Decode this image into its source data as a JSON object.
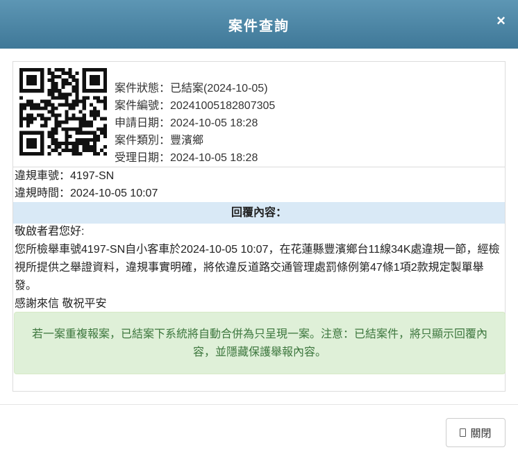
{
  "header": {
    "title": "案件查詢",
    "close_glyph": "×"
  },
  "case": {
    "rows": [
      {
        "label": "案件狀態：",
        "value": "已結案(2024-10-05)"
      },
      {
        "label": "案件編號：",
        "value": "20241005182807305"
      },
      {
        "label": "申請日期：",
        "value": "2024-10-05 18:28"
      },
      {
        "label": "案件類別：",
        "value": "豐濱鄉"
      },
      {
        "label": "受理日期：",
        "value": "2024-10-05 18:28"
      }
    ]
  },
  "violation": {
    "plate_label": "違規車號：",
    "plate": "4197-SN",
    "time_label": "違規時間：",
    "time": "2024-10-05 10:07"
  },
  "reply": {
    "heading": "回覆內容：",
    "greeting": "敬啟者君您好:",
    "body": "您所檢舉車號4197-SN自小客車於2024-10-05 10:07，在花蓮縣豐濱鄉台11線34K處違規一節，經檢視所提供之舉證資料，違規事實明確，將依違反道路交通管理處罰條例第47條1項2款規定製單舉發。",
    "closing": "感謝來信 敬祝平安"
  },
  "notice": "若一案重複報案，已結案下系統將自動合併為只呈現一案。注意：已結案件，將只顯示回覆內容，並隱藏保護舉報內容。",
  "footer": {
    "close_label": "關閉"
  }
}
